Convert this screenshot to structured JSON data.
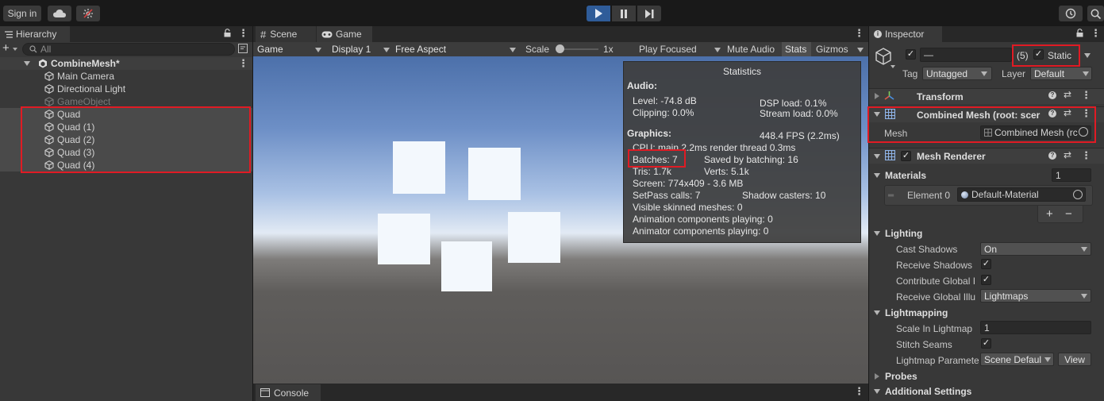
{
  "toolbar": {
    "sign_in": "Sign in",
    "cloud_icon": "cloud-icon",
    "collab_icon": "collab-icon",
    "history_icon": "history-icon",
    "search_icon": "search-icon",
    "accent": "#2f5c99"
  },
  "hierarchy": {
    "tab_label": "Hierarchy",
    "search_placeholder": "All",
    "scene_name": "CombineMesh*",
    "items": [
      {
        "label": "Main Camera",
        "selected": false,
        "disabled": false
      },
      {
        "label": "Directional Light",
        "selected": false,
        "disabled": false
      },
      {
        "label": "GameObject",
        "selected": false,
        "disabled": true
      },
      {
        "label": "Quad",
        "selected": true,
        "disabled": false
      },
      {
        "label": "Quad (1)",
        "selected": true,
        "disabled": false
      },
      {
        "label": "Quad (2)",
        "selected": true,
        "disabled": false
      },
      {
        "label": "Quad (3)",
        "selected": true,
        "disabled": false
      },
      {
        "label": "Quad (4)",
        "selected": true,
        "disabled": false
      }
    ]
  },
  "game": {
    "tabs": [
      {
        "label": "Scene"
      },
      {
        "label": "Game"
      }
    ],
    "controls": {
      "view": "Game",
      "display": "Display 1",
      "aspect": "Free Aspect",
      "scale_label": "Scale",
      "scale_value": "1x",
      "play_mode": "Play Focused",
      "mute": "Mute Audio",
      "stats": "Stats",
      "gizmos": "Gizmos"
    }
  },
  "stats": {
    "title": "Statistics",
    "audio_header": "Audio:",
    "level": "Level: -74.8 dB",
    "clipping": "Clipping: 0.0%",
    "dsp_load": "DSP load: 0.1%",
    "stream_load": "Stream load: 0.0%",
    "graphics_header": "Graphics:",
    "fps": "448.4 FPS (2.2ms)",
    "cpu": "CPU: main 2.2ms  render thread 0.3ms",
    "batches": "Batches: 7",
    "saved_batching": "Saved by batching: 16",
    "tris": "Tris: 1.7k",
    "verts": "Verts: 5.1k",
    "screen": "Screen: 774x409 - 3.6 MB",
    "setpass": "SetPass calls: 7",
    "shadow_casters": "Shadow casters: 10",
    "skinned": "Visible skinned meshes: 0",
    "animation": "Animation components playing: 0",
    "animator": "Animator components playing: 0"
  },
  "console": {
    "tab_label": "Console"
  },
  "inspector": {
    "tab_label": "Inspector",
    "name_value": "—",
    "static_count": "(5)",
    "static_label": "Static",
    "tag_label": "Tag",
    "tag_value": "Untagged",
    "layer_label": "Layer",
    "layer_value": "Default",
    "transform_label": "Transform",
    "combined_label": "Combined Mesh (root: scer",
    "mesh_label": "Mesh",
    "mesh_value": "Combined Mesh (rc",
    "renderer_label": "Mesh Renderer",
    "materials_label": "Materials",
    "materials_count": "1",
    "element0_label": "Element 0",
    "element0_value": "Default-Material",
    "plus": "+",
    "minus": "−",
    "lighting_label": "Lighting",
    "cast_shadows_label": "Cast Shadows",
    "cast_shadows_value": "On",
    "receive_shadows_label": "Receive Shadows",
    "contribute_gi_label": "Contribute Global I",
    "receive_gi_label": "Receive Global Illu",
    "receive_gi_value": "Lightmaps",
    "lightmapping_label": "Lightmapping",
    "scale_lightmap_label": "Scale In Lightmap",
    "scale_lightmap_value": "1",
    "stitch_seams_label": "Stitch Seams",
    "lightmap_params_label": "Lightmap Paramete",
    "lightmap_params_value": "Scene Defaul",
    "view_button": "View",
    "probes_label": "Probes",
    "additional_label": "Additional Settings"
  },
  "highlight_color": "#e01b24"
}
